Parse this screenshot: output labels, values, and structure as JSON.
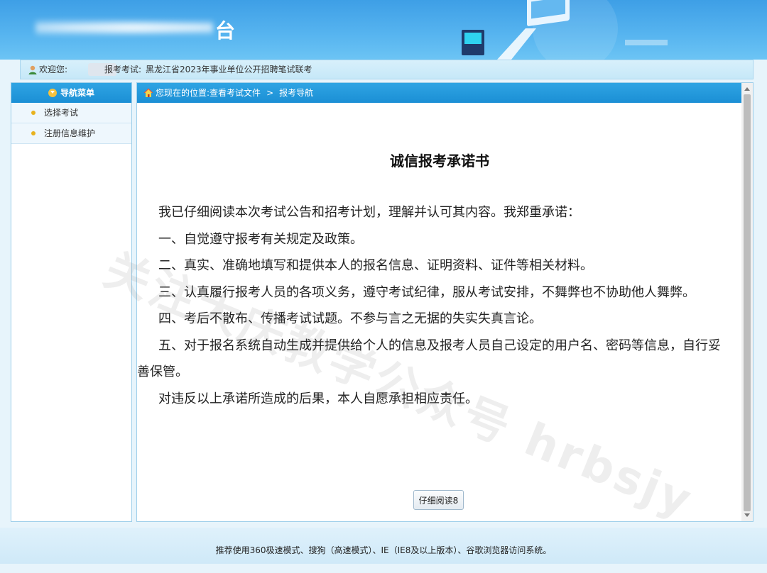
{
  "header": {
    "title_visible_char": "台"
  },
  "welcome_bar": {
    "welcome_label": "欢迎您:",
    "exam_label": "报考考试:",
    "exam_name": "黑龙江省2023年事业单位公开招聘笔试联考"
  },
  "sidebar": {
    "header": "导航菜单",
    "items": [
      {
        "label": "选择考试"
      },
      {
        "label": "注册信息维护"
      }
    ]
  },
  "breadcrumb": {
    "prefix": "您现在的位置:",
    "items": [
      "查看考试文件",
      "报考导航"
    ],
    "separator": ">"
  },
  "document": {
    "title": "诚信报考承诺书",
    "paragraphs": [
      "我已仔细阅读本次考试公告和招考计划，理解并认可其内容。我郑重承诺：",
      "一、自觉遵守报考有关规定及政策。",
      "二、真实、准确地填写和提供本人的报名信息、证明资料、证件等相关材料。",
      "三、认真履行报考人员的各项义务，遵守考试纪律，服从考试安排，不舞弊也不协助他人舞弊。",
      "四、考后不散布、传播考试试题。不参与言之无据的失实失真言论。",
      "五、对于报名系统自动生成并提供给个人的信息及报考人员自己设定的用户名、密码等信息，自行妥善保管。",
      "对违反以上承诺所造成的后果，本人自愿承担相应责任。"
    ],
    "read_button": "仔细阅读8"
  },
  "watermark": "关注大庆教学公众号 hrbsjy",
  "footer": {
    "text": "推荐使用360极速模式、搜狗（高速模式）、IE（IE8及以上版本）、谷歌浏览器访问系统。"
  },
  "icons": {
    "user": "user-icon",
    "home": "home-icon",
    "menu": "chevron-down-circle-icon"
  },
  "colors": {
    "banner": "#3e9fe6",
    "panel_header": "#1b8fd5",
    "accent_dot": "#e8b21e"
  }
}
